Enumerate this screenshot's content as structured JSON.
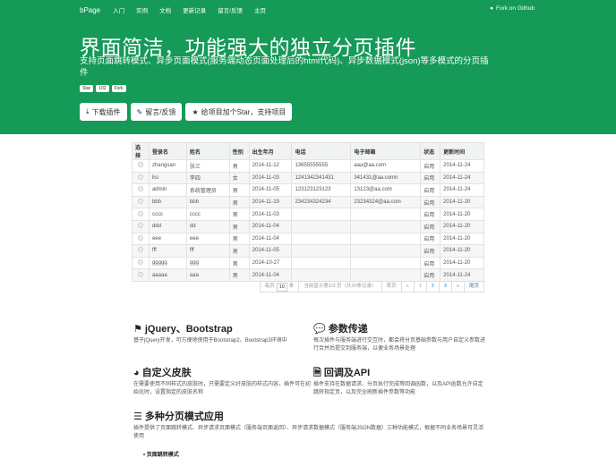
{
  "nav": {
    "brand": "bPage",
    "items": [
      "入门",
      "实例",
      "文档",
      "更新记录",
      "留言/反馈",
      "主页"
    ],
    "github": "Fork on Github"
  },
  "hero": {
    "title": "界面简洁，功能强大的独立分页插件",
    "subtitle": "支持页面跳转模式、异步页面模式(服务端动态页面处理后的html代码)、异步数据模式(json)等多模式的分页插件",
    "badges": {
      "star": "Star",
      "count": "102",
      "fork": "Fork"
    },
    "buttons": {
      "download": "下载插件",
      "feedback": "留言/反馈",
      "star": "给项目加个Star，支持项目"
    }
  },
  "table": {
    "headers": [
      "选择",
      "登录名",
      "姓名",
      "性别",
      "出生年月",
      "电话",
      "电子邮箱",
      "状态",
      "更新时间"
    ],
    "rows": [
      [
        "zhangsan",
        "张三",
        "男",
        "2014-11-12",
        "13655555555",
        "aaa@aa.com",
        "启用",
        "2014-11-24"
      ],
      [
        "lisi",
        "李四",
        "女",
        "2014-11-03",
        "1241342341431",
        "341431@aa.comn",
        "启用",
        "2014-11-24"
      ],
      [
        "admin",
        "系统管理员",
        "男",
        "2014-11-05",
        "123123123123",
        "13123@aa.com",
        "启用",
        "2014-11-24"
      ],
      [
        "bbb",
        "bbb",
        "男",
        "2014-11-19",
        "234234324234",
        "23234324@aa.com",
        "启用",
        "2014-11-20"
      ],
      [
        "cccc",
        "cccc",
        "男",
        "2014-11-03",
        "",
        "",
        "启用",
        "2014-11-20"
      ],
      [
        "ddd",
        "dd",
        "男",
        "2014-11-04",
        "",
        "",
        "启用",
        "2014-11-20"
      ],
      [
        "eee",
        "eee",
        "男",
        "2014-11-04",
        "",
        "",
        "启用",
        "2014-11-20"
      ],
      [
        "fff",
        "fff",
        "男",
        "2014-11-05",
        "",
        "",
        "启用",
        "2014-11-20"
      ],
      [
        "ggggg",
        "ggg",
        "男",
        "2014-10-27",
        "",
        "",
        "启用",
        "2014-11-20"
      ],
      [
        "aaaaa",
        "aaa",
        "男",
        "2014-11-04",
        "",
        "",
        "启用",
        "2014-11-24"
      ]
    ]
  },
  "pager": {
    "per_page_label": "每页",
    "per_page": "10",
    "unit": "条",
    "info": "当前显示第1/3 页（共30条记录）",
    "first": "首页",
    "prev": "«",
    "pages": [
      "1",
      "2",
      "3"
    ],
    "next": "»",
    "last": "尾页"
  },
  "features": [
    {
      "title": "jQuery、Bootstrap",
      "text": "基于jQuery开发，可方便地使用于Bootstrap2、Bootstrap3环境中"
    },
    {
      "title": "参数传递",
      "text": "每次插件与服务端进行交互时，都会将分页基础参数与用户自定义参数进行合并后提交到服务端，以便业务场景处理"
    },
    {
      "title": "自定义皮肤",
      "text": "在需要使用不同样式的皮肤时，只需要定义好皮肤的样式内容，插件可在初始化时，设置指定的皮肤名称"
    },
    {
      "title": "回调及API",
      "text": "插件支持在数据请求、分页执行完成等回调函数，以及API函数允许自定跳转指定页，以及完全刷新插件参数等功能"
    },
    {
      "title": "多种分页模式应用",
      "text": "插件提供了页面跳转模式、异步请求页面模式（服务端页面返回）、异步请求数据模式（服务端JSON数据）三种功能模式，根据不同业务场景可灵活使用"
    }
  ],
  "list_item": "页面跳转模式"
}
